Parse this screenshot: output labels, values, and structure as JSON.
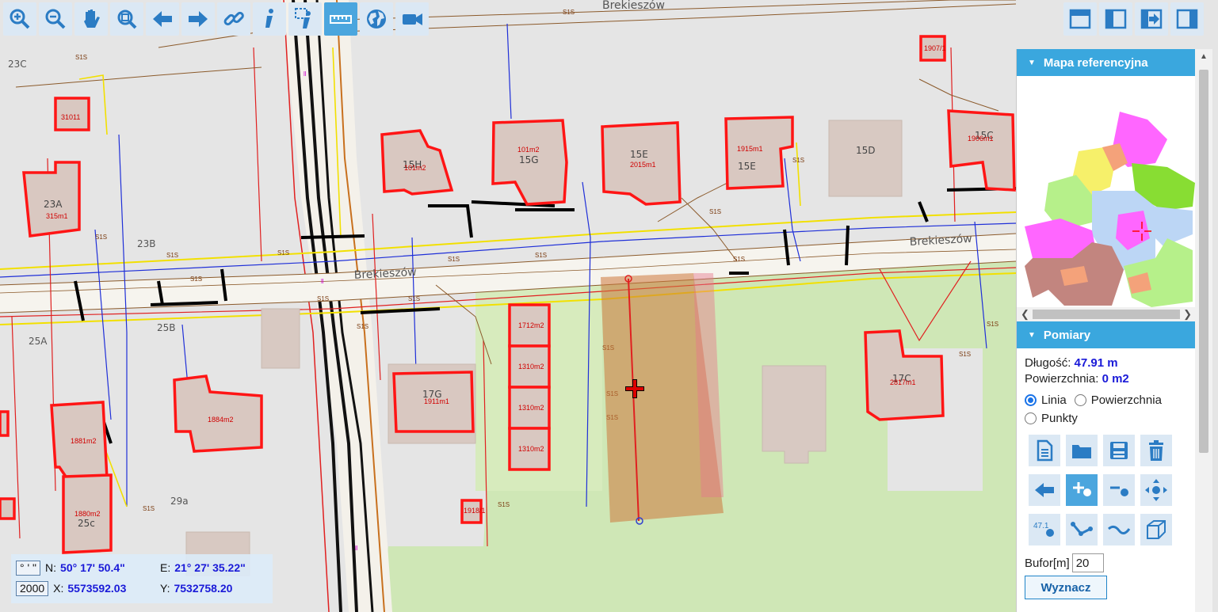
{
  "map": {
    "road_labels": [
      "Brekieszów",
      "Brekieszów",
      "Brekieszów"
    ],
    "parcel_labels": [
      "23C",
      "23A",
      "23B",
      "25B",
      "25A",
      "29a",
      "25c",
      "15H",
      "15G",
      "15E",
      "15E",
      "15D",
      "15C",
      "17G",
      "17C"
    ],
    "building_areas": [
      "31011",
      "315m1",
      "101m2",
      "101m2",
      "2015m1",
      "1915m1",
      "1906m1",
      "1907/1",
      "1911m1",
      "1884m2",
      "1881m2",
      "1880m2",
      "1712m2",
      "1310m2",
      "1310m2",
      "1310m2",
      "1918/1",
      "2817m1"
    ]
  },
  "toolbar_left": {
    "buttons": [
      {
        "icon": "zoom-in-icon"
      },
      {
        "icon": "zoom-out-icon"
      },
      {
        "icon": "pan-hand-icon"
      },
      {
        "icon": "zoom-extent-icon"
      },
      {
        "icon": "back-arrow-icon"
      },
      {
        "icon": "forward-arrow-icon"
      },
      {
        "icon": "link-icon"
      },
      {
        "icon": "info-icon"
      },
      {
        "icon": "info-select-icon"
      },
      {
        "icon": "ruler-icon",
        "active": true
      },
      {
        "icon": "globe-icon"
      },
      {
        "icon": "video-camera-icon"
      }
    ]
  },
  "toolbar_right": {
    "buttons": [
      {
        "icon": "layout-top-icon"
      },
      {
        "icon": "layout-left-icon"
      },
      {
        "icon": "layout-arrow-icon"
      },
      {
        "icon": "layout-right-icon"
      }
    ]
  },
  "panel": {
    "ref_map_title": "Mapa referencyjna",
    "measure_title": "Pomiary",
    "length_label": "Długość:",
    "length_value": "47.91 m",
    "area_label": "Powierzchnia:",
    "area_value": "0 m2",
    "radio_options": [
      {
        "label": "Linia",
        "selected": true
      },
      {
        "label": "Powierzchnia",
        "selected": false
      },
      {
        "label": "Punkty",
        "selected": false
      }
    ],
    "measure_tool_icons": [
      "new-document-icon",
      "open-folder-icon",
      "save-icon",
      "delete-icon",
      "undo-arrow-icon",
      "add-point-icon",
      "remove-point-icon",
      "move-point-icon",
      "label-value-icon",
      "polyline-icon",
      "profile-curve-icon",
      "3d-box-icon"
    ],
    "buffer_label": "Bufor[m]",
    "buffer_value": "20",
    "compute_button": "Wyznacz"
  },
  "coordinates": {
    "dms_badge": "° ' \"",
    "n_label": "N:",
    "n_value": "50° 17' 50.4\"",
    "e_label": "E:",
    "e_value": "21° 27' 35.22\"",
    "crs_badge": "2000",
    "x_label": "X:",
    "x_value": "5573592.03",
    "y_label": "Y:",
    "y_value": "7532758.20"
  },
  "colors": {
    "accent": "#3aa7de",
    "building_outline": "#ff0000",
    "measure_line": "#e02020",
    "value_text": "#1a1ad8"
  }
}
